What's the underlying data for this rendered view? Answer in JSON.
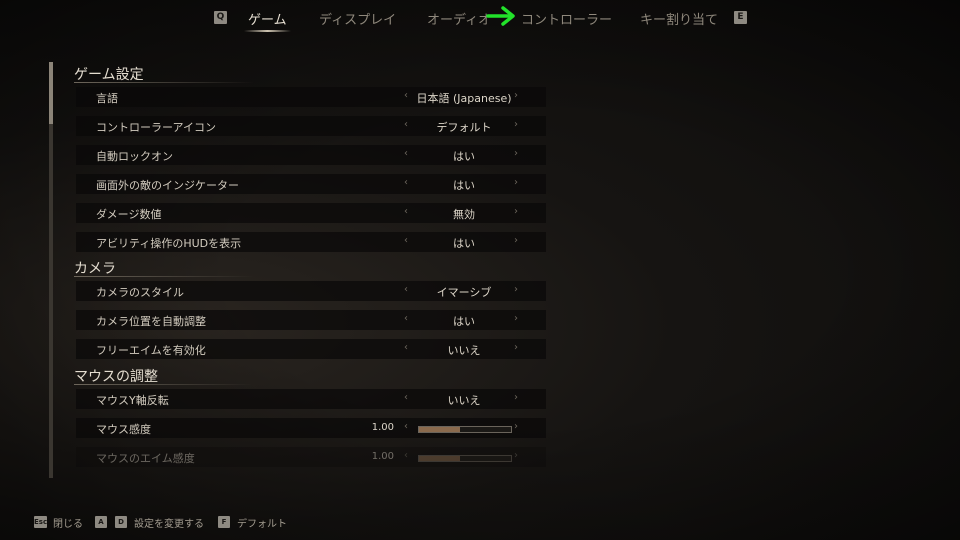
{
  "tabs": {
    "prev_key": "Q",
    "next_key": "E",
    "items": [
      {
        "label": "ゲーム"
      },
      {
        "label": "ディスプレイ"
      },
      {
        "label": "オーディオ"
      },
      {
        "label": "コントローラー"
      },
      {
        "label": "キー割り当て"
      }
    ],
    "active": "ゲーム"
  },
  "sections": {
    "game": {
      "title": "ゲーム設定",
      "rows": [
        {
          "label": "言語",
          "value": "日本語 (Japanese)"
        },
        {
          "label": "コントローラーアイコン",
          "value": "デフォルト"
        },
        {
          "label": "自動ロックオン",
          "value": "はい"
        },
        {
          "label": "画面外の敵のインジケーター",
          "value": "はい"
        },
        {
          "label": "ダメージ数値",
          "value": "無効"
        },
        {
          "label": "アビリティ操作のHUDを表示",
          "value": "はい"
        }
      ]
    },
    "camera": {
      "title": "カメラ",
      "rows": [
        {
          "label": "カメラのスタイル",
          "value": "イマーシブ"
        },
        {
          "label": "カメラ位置を自動調整",
          "value": "はい"
        },
        {
          "label": "フリーエイムを有効化",
          "value": "いいえ"
        }
      ]
    },
    "mouse": {
      "title": "マウスの調整",
      "rows": [
        {
          "label": "マウスY軸反転",
          "value": "いいえ"
        },
        {
          "label": "マウス感度",
          "value": "1.00",
          "fill": 0.45
        },
        {
          "label": "マウスのエイム感度",
          "value": "1.00",
          "fill": 0.45
        }
      ]
    }
  },
  "footer": {
    "close_key": "Esc",
    "close_label": "閉じる",
    "change_key_a": "A",
    "change_key_d": "D",
    "change_label": "設定を変更する",
    "default_key": "F",
    "default_label": "デフォルト"
  },
  "colors": {
    "arrow": "#22e22a",
    "slider_fill": "#8a6a4d"
  }
}
